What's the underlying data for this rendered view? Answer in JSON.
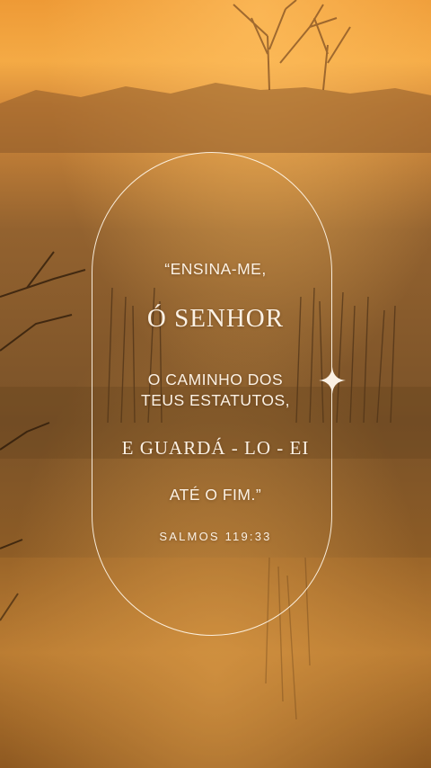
{
  "quote": {
    "line1": "“ENSINA-ME,",
    "line2": "Ó SENHOR",
    "line3": "O CAMINHO DOS",
    "line4": "TEUS ESTATUTOS,",
    "line5": "E GUARDÁ - LO - EI",
    "line6": "ATÉ O FIM.”",
    "reference": "SALMOS 119:33"
  },
  "icons": {
    "sparkle": "four-point-star-icon"
  },
  "colors": {
    "sky": "#f2a23a",
    "haze": "#9a6428",
    "water": "#c98a3a",
    "text": "#fbf1e4"
  }
}
